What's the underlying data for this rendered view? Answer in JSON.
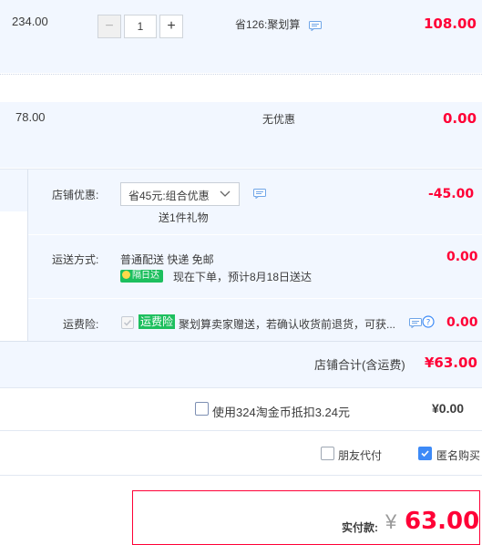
{
  "item1": {
    "unit_price": "234.00",
    "quantity": "1",
    "decrease_label": "−",
    "increase_label": "+",
    "discount": "省126:聚划算",
    "subtotal": "108.00"
  },
  "item2": {
    "unit_price": "78.00",
    "discount": "无优惠",
    "subtotal": "0.00"
  },
  "shop_discount": {
    "label": "店铺优惠:",
    "selected": "省45元:组合优惠",
    "gift": "送1件礼物",
    "amount": "-45.00"
  },
  "shipping": {
    "label": "运送方式:",
    "method": "普通配送 快递 免邮",
    "badge": "隔日达",
    "estimate": "现在下单，预计8月18日送达",
    "amount": "0.00"
  },
  "shipping_insurance": {
    "label": "运费险:",
    "badge": "运费险",
    "text": "聚划算卖家赠送，若确认收货前退货，可获...",
    "amount": "0.00"
  },
  "shop_total": {
    "label": "店铺合计(含运费)",
    "amount": "¥63.00"
  },
  "taojinbi": {
    "label": "使用324淘金币抵扣3.24元",
    "amount": "¥0.00"
  },
  "options": {
    "friend_pay": "朋友代付",
    "anonymous": "匿名购买"
  },
  "payment": {
    "label": "实付款:",
    "currency": "¥",
    "amount": "63.00"
  },
  "colors": {
    "price_red": "#ff0036",
    "accent_blue": "#3d8af7",
    "badge_green": "#1dbf5e",
    "panel_bg": "#f2f7ff"
  }
}
